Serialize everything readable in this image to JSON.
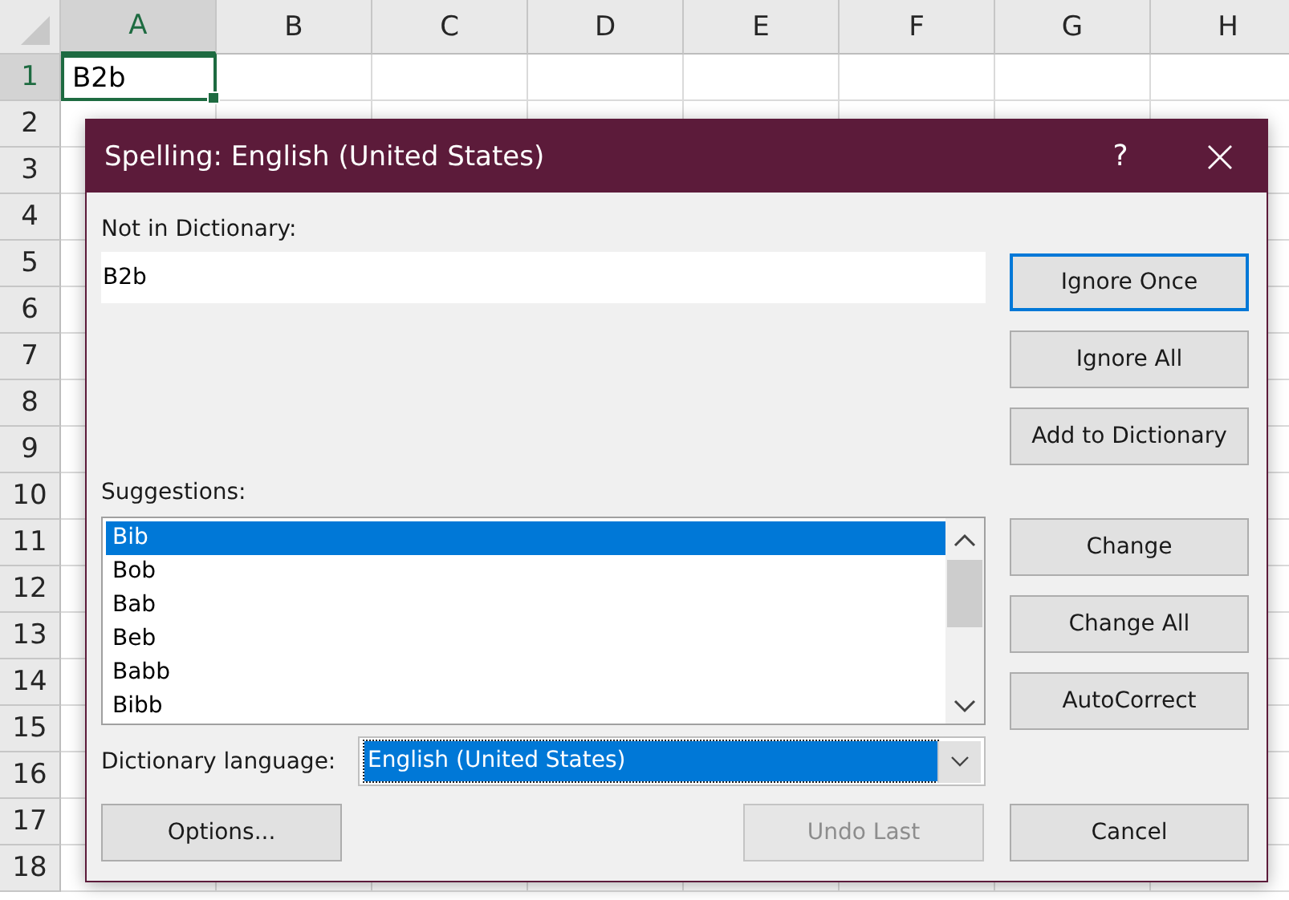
{
  "sheet": {
    "columns": [
      {
        "label": "A",
        "selected": true
      },
      {
        "label": "B",
        "selected": false
      },
      {
        "label": "C",
        "selected": false
      },
      {
        "label": "D",
        "selected": false
      },
      {
        "label": "E",
        "selected": false
      },
      {
        "label": "F",
        "selected": false
      },
      {
        "label": "G",
        "selected": false
      },
      {
        "label": "H",
        "selected": false
      }
    ],
    "rows": [
      {
        "label": "1",
        "selected": true,
        "cells": [
          {
            "value": "B2b",
            "selected": true
          }
        ]
      },
      {
        "label": "2",
        "selected": false
      },
      {
        "label": "3",
        "selected": false
      },
      {
        "label": "4",
        "selected": false
      },
      {
        "label": "5",
        "selected": false
      },
      {
        "label": "6",
        "selected": false
      },
      {
        "label": "7",
        "selected": false
      },
      {
        "label": "8",
        "selected": false
      },
      {
        "label": "9",
        "selected": false
      },
      {
        "label": "10",
        "selected": false
      },
      {
        "label": "11",
        "selected": false
      },
      {
        "label": "12",
        "selected": false
      },
      {
        "label": "13",
        "selected": false
      },
      {
        "label": "14",
        "selected": false
      },
      {
        "label": "15",
        "selected": false
      },
      {
        "label": "16",
        "selected": false
      },
      {
        "label": "17",
        "selected": false
      },
      {
        "label": "18",
        "selected": false
      }
    ]
  },
  "dialog": {
    "title": "Spelling: English (United States)",
    "help": "?",
    "not_in_dictionary": {
      "label": "Not in Dictionary:",
      "value": "B2b"
    },
    "suggestions": {
      "label": "Suggestions:",
      "items": [
        {
          "text": "Bib",
          "selected": true
        },
        {
          "text": "Bob",
          "selected": false
        },
        {
          "text": "Bab",
          "selected": false
        },
        {
          "text": "Beb",
          "selected": false
        },
        {
          "text": "Babb",
          "selected": false
        },
        {
          "text": "Bibb",
          "selected": false
        }
      ]
    },
    "dictionary_language": {
      "label": "Dictionary language:",
      "value": "English (United States)",
      "selected": true
    },
    "side_buttons": [
      {
        "label": "Ignore Once",
        "default": true,
        "disabled": false
      },
      {
        "label": "Ignore All",
        "default": false,
        "disabled": false
      },
      {
        "label": "Add to Dictionary",
        "default": false,
        "disabled": false
      }
    ],
    "change_buttons": [
      {
        "label": "Change",
        "default": false,
        "disabled": false
      },
      {
        "label": "Change All",
        "default": false,
        "disabled": false
      },
      {
        "label": "AutoCorrect",
        "default": false,
        "disabled": false
      }
    ],
    "bottom_buttons": [
      {
        "label": "Options...",
        "default": false,
        "disabled": false
      },
      {
        "label": "Undo Last",
        "default": false,
        "disabled": true
      },
      {
        "label": "Cancel",
        "default": false,
        "disabled": false
      }
    ]
  }
}
